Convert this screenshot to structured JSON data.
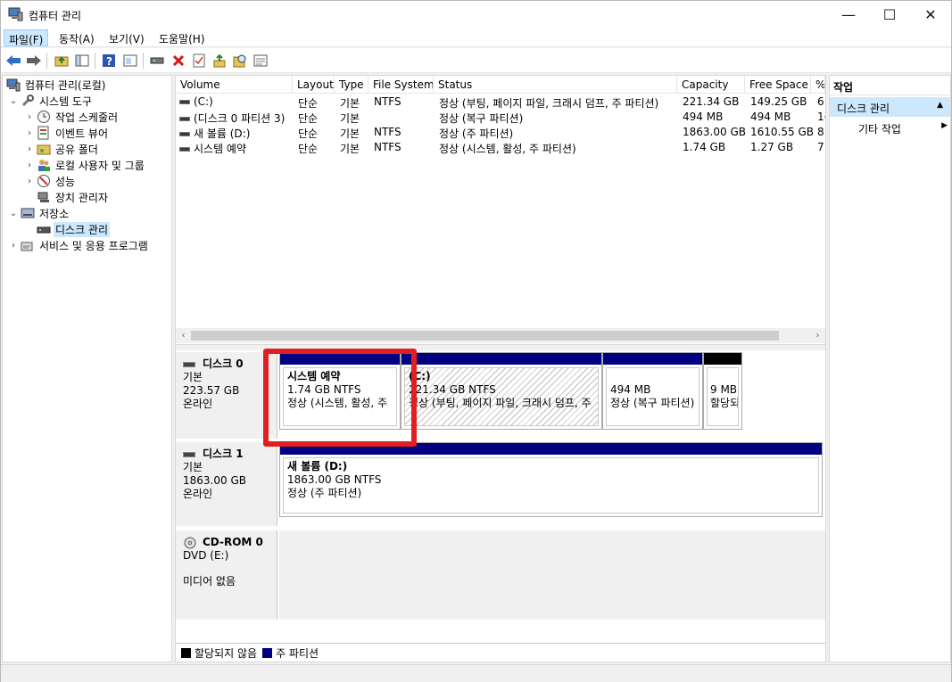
{
  "window": {
    "title": "컴퓨터 관리",
    "minimize_glyph": "—",
    "maximize_glyph": "☐",
    "close_glyph": "✕"
  },
  "menu": [
    "파일(F)",
    "동작(A)",
    "보기(V)",
    "도움말(H)"
  ],
  "tree": {
    "root": "컴퓨터 관리(로컬)",
    "system_tools": "시스템 도구",
    "task_scheduler": "작업 스케줄러",
    "event_viewer": "이벤트 뷰어",
    "shared_folders": "공유 폴더",
    "local_users": "로컬 사용자 및 그룹",
    "performance": "성능",
    "device_manager": "장치 관리자",
    "storage": "저장소",
    "disk_management": "디스크 관리",
    "services": "서비스 및 응용 프로그램"
  },
  "volume_table": {
    "headers": [
      "Volume",
      "Layout",
      "Type",
      "File System",
      "Status",
      "Capacity",
      "Free Space",
      "%"
    ],
    "rows": [
      [
        "(C:)",
        "단순",
        "기본",
        "NTFS",
        "정상 (부팅, 페이지 파일, 크래시 덤프, 주 파티션)",
        "221.34 GB",
        "149.25 GB",
        "6"
      ],
      [
        "(디스크 0 파티션 3)",
        "단순",
        "기본",
        "",
        "정상 (복구 파티션)",
        "494 MB",
        "494 MB",
        "1("
      ],
      [
        "새 볼륨 (D:)",
        "단순",
        "기본",
        "NTFS",
        "정상 (주 파티션)",
        "1863.00 GB",
        "1610.55 GB",
        "8"
      ],
      [
        "시스템 예약",
        "단순",
        "기본",
        "NTFS",
        "정상 (시스템, 활성, 주 파티션)",
        "1.74 GB",
        "1.27 GB",
        "7"
      ]
    ]
  },
  "disks": {
    "disk0": {
      "name": "디스크 0",
      "type": "기본",
      "size": "223.57 GB",
      "state": "온라인",
      "p1": {
        "name": "시스템 예약",
        "size": "1.74 GB NTFS",
        "status": "정상 (시스템, 활성, 주"
      },
      "p2": {
        "name": "(C:)",
        "size": "221.34 GB NTFS",
        "status": "정상 (부팅, 페이지 파일, 크래시 덤프, 주"
      },
      "p3": {
        "size": "494 MB",
        "status": "정상 (복구 파티션)"
      },
      "p4": {
        "size": "9 MB",
        "status": "할당되지 않음"
      }
    },
    "disk1": {
      "name": "디스크 1",
      "type": "기본",
      "size": "1863.00 GB",
      "state": "온라인",
      "p1": {
        "name": "새 볼륨  (D:)",
        "size": "1863.00 GB NTFS",
        "status": "정상 (주 파티션)"
      }
    },
    "cdrom0": {
      "name": "CD-ROM 0",
      "drive": "DVD (E:)",
      "state": "미디어 없음"
    }
  },
  "legend": {
    "unallocated": "할당되지 않음",
    "primary": "주 파티션"
  },
  "actions": {
    "header": "작업",
    "section": "디스크 관리",
    "more": "기타 작업"
  },
  "colors": {
    "primary_partition": "#000080",
    "unallocated": "#000000",
    "selection": "#cce8ff",
    "highlight_box": "#e02020"
  }
}
